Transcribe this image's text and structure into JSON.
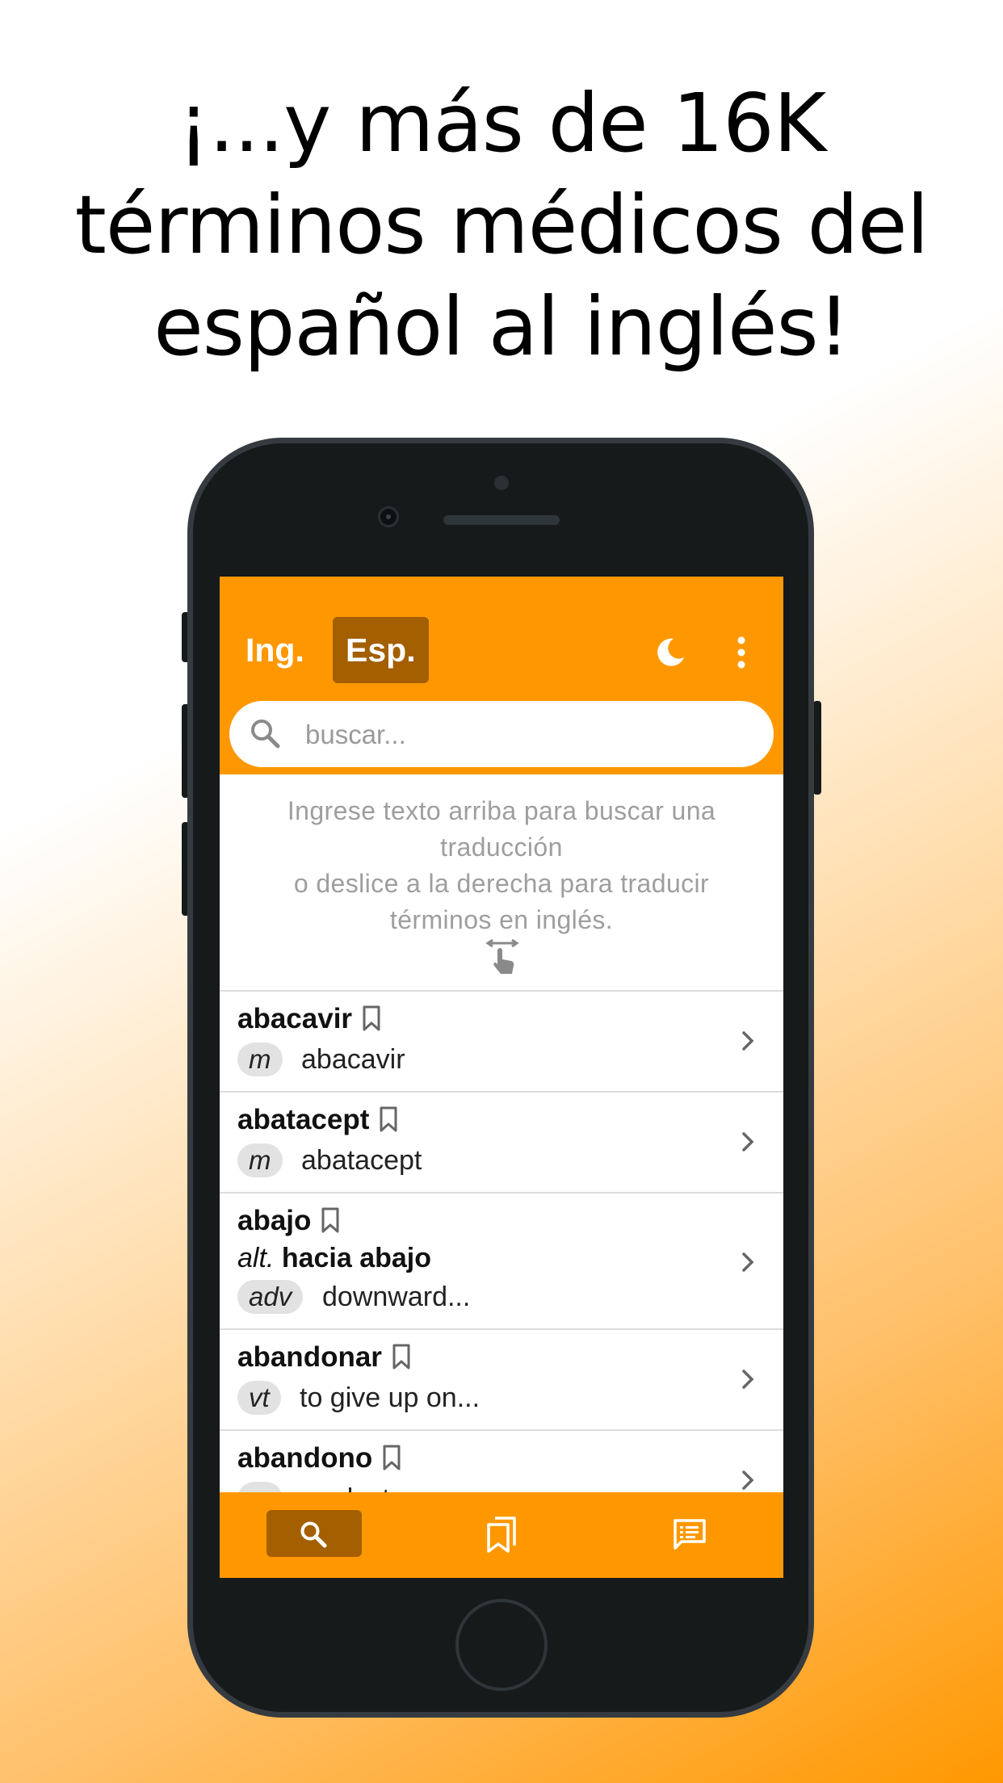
{
  "headline": {
    "line1": "¡...y más de 16K",
    "line2": "términos médicos del",
    "line3": "español al inglés!"
  },
  "app_bar": {
    "tab_english": "Ing.",
    "tab_spanish": "Esp.",
    "active_tab": "Esp.",
    "icons": [
      "moon-icon",
      "more-vertical-icon"
    ]
  },
  "search": {
    "placeholder": "buscar...",
    "value": ""
  },
  "hint": {
    "line1": "Ingrese texto arriba para buscar una",
    "line2": "traducción",
    "line3": "o deslice a la derecha para traducir",
    "line4": "términos en inglés."
  },
  "entries": [
    {
      "term": "abacavir",
      "pos": "m",
      "translation": "abacavir"
    },
    {
      "term": "abatacept",
      "pos": "m",
      "translation": "abatacept"
    },
    {
      "term": "abajo",
      "alt_label": "alt.",
      "alt_term": "hacia abajo",
      "pos": "adv",
      "translation": "downward..."
    },
    {
      "term": "abandonar",
      "pos": "vt",
      "translation": "to give up on..."
    },
    {
      "term": "abandono",
      "pos": "m",
      "translation": "neglect"
    }
  ],
  "bottom_nav": {
    "items": [
      "search-icon",
      "bookmarks-icon",
      "feedback-icon"
    ],
    "active": "search-icon"
  },
  "colors": {
    "accent": "#ff9800",
    "accent_dark": "#a35f00",
    "phone_body": "#161a1b"
  }
}
